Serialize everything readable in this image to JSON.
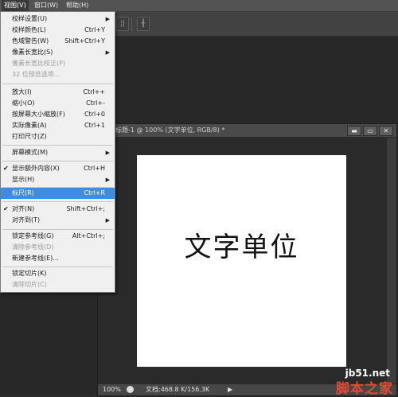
{
  "menubar": {
    "items": [
      {
        "label": "视图(V)"
      },
      {
        "label": "窗口(W)"
      },
      {
        "label": "帮助(H)"
      }
    ]
  },
  "optionsbar": {
    "btn1_glyph": "¦|",
    "btn2_glyph": "╫"
  },
  "document": {
    "title": "标题-1 @ 100% (文字单位, RGB/8) *",
    "canvas_text": "文字单位",
    "zoom": "100%",
    "doc_size": "文档:468.8 K/156.3K",
    "win_minimize": "▬",
    "win_restore": "▭",
    "win_close": "✕"
  },
  "view_menu": {
    "items": [
      {
        "label": "校样设置(U)",
        "shortcut": "",
        "submenu": true
      },
      {
        "label": "校样颜色(L)",
        "shortcut": "Ctrl+Y"
      },
      {
        "label": "色域警告(W)",
        "shortcut": "Shift+Ctrl+Y"
      },
      {
        "label": "像素长宽比(S)",
        "shortcut": "",
        "submenu": true
      },
      {
        "label": "像素长宽比校正(P)",
        "shortcut": "",
        "disabled": true
      },
      {
        "label": "32 位预览选项...",
        "shortcut": "",
        "disabled": true
      },
      {
        "label": "放大(I)",
        "shortcut": "Ctrl++"
      },
      {
        "label": "缩小(O)",
        "shortcut": "Ctrl+-"
      },
      {
        "label": "按屏幕大小缩放(F)",
        "shortcut": "Ctrl+0"
      },
      {
        "label": "实际像素(A)",
        "shortcut": "Ctrl+1"
      },
      {
        "label": "打印尺寸(Z)",
        "shortcut": ""
      },
      {
        "label": "屏幕模式(M)",
        "shortcut": "",
        "submenu": true
      },
      {
        "label": "显示额外内容(X)",
        "shortcut": "Ctrl+H",
        "checked": true
      },
      {
        "label": "显示(H)",
        "shortcut": "",
        "submenu": true
      },
      {
        "label": "标尺(R)",
        "shortcut": "Ctrl+R",
        "highlighted": true
      },
      {
        "label": "对齐(N)",
        "shortcut": "Shift+Ctrl+;",
        "checked": true
      },
      {
        "label": "对齐到(T)",
        "shortcut": "",
        "submenu": true
      },
      {
        "label": "锁定参考线(G)",
        "shortcut": "Alt+Ctrl+;"
      },
      {
        "label": "清除参考线(D)",
        "shortcut": "",
        "disabled": true
      },
      {
        "label": "新建参考线(E)...",
        "shortcut": ""
      },
      {
        "label": "锁定切片(K)",
        "shortcut": ""
      },
      {
        "label": "清除切片(C)",
        "shortcut": "",
        "disabled": true
      }
    ]
  },
  "watermark": {
    "site": "jb51.net",
    "name": "脚本之家"
  }
}
